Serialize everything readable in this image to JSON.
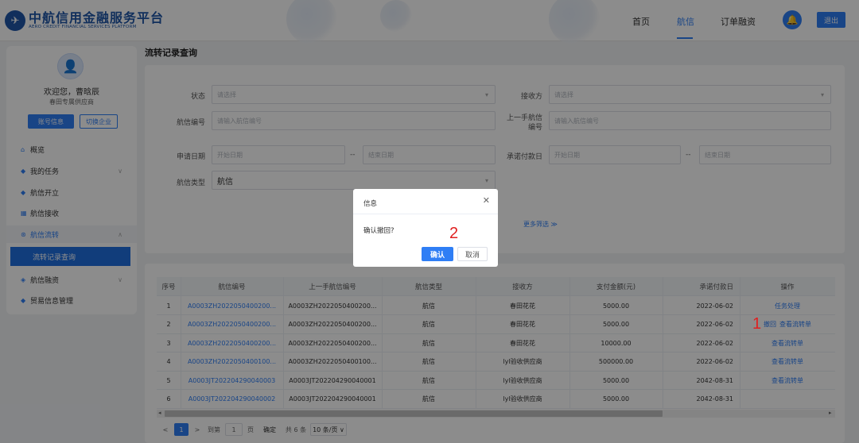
{
  "header": {
    "logo_title": "中航信用金融服务平台",
    "logo_subtitle": "AERO CREDIT FINANCIAL SERVICES PLATFORM",
    "nav": [
      "首页",
      "航信",
      "订单融资"
    ],
    "active_nav": "航信",
    "logout_label": "退出"
  },
  "sidebar": {
    "welcome": "欢迎您，曹晗辰",
    "role": "春田专属供应商",
    "account_button": "账号信息",
    "switch_button": "切换企业",
    "menu": [
      {
        "label": "概览",
        "icon": "home-icon"
      },
      {
        "label": "我的任务",
        "icon": "task-icon",
        "expandable": true
      },
      {
        "label": "航信开立",
        "icon": "open-icon"
      },
      {
        "label": "航信接收",
        "icon": "receive-icon"
      },
      {
        "label": "航信流转",
        "icon": "transfer-icon",
        "expandable": true,
        "expanded": true
      },
      {
        "label": "航信融资",
        "icon": "finance-icon",
        "expandable": true
      },
      {
        "label": "贸易信息管理",
        "icon": "trade-icon"
      }
    ],
    "active_submenu": "流转记录查询"
  },
  "page": {
    "title": "流转记录查询"
  },
  "filters": {
    "status_label": "状态",
    "status_placeholder": "请选择",
    "receiver_label": "接收方",
    "receiver_placeholder": "请选择",
    "code_label": "航信编号",
    "code_placeholder": "请输入航信编号",
    "prev_code_label_line1": "上一手航信",
    "prev_code_label_line2": "编号",
    "prev_code_placeholder": "请输入航信编号",
    "apply_date_label": "申请日期",
    "start_placeholder": "开始日期",
    "end_placeholder": "结束日期",
    "date_separator": "--",
    "pay_date_label": "承诺付款日",
    "pay_start_placeholder": "开始日期",
    "pay_end_placeholder": "结束日期",
    "type_label": "航信类型",
    "type_value": "航信",
    "more_filters": "更多筛选 ≫"
  },
  "table": {
    "columns": [
      "序号",
      "航信编号",
      "上一手航信编号",
      "航信类型",
      "接收方",
      "支付金额(元)",
      "承诺付款日",
      "操作"
    ],
    "rows": [
      {
        "no": "1",
        "code": "A0003ZH2022050400200...",
        "prev": "A0003ZH2022050400200...",
        "type": "航信",
        "receiver": "春田花花",
        "amount": "5000.00",
        "date": "2022-06-02",
        "actions": [
          "任务处理"
        ]
      },
      {
        "no": "2",
        "code": "A0003ZH2022050400200...",
        "prev": "A0003ZH2022050400200...",
        "type": "航信",
        "receiver": "春田花花",
        "amount": "5000.00",
        "date": "2022-06-02",
        "actions": [
          "撤回",
          "查看流转单"
        ]
      },
      {
        "no": "3",
        "code": "A0003ZH2022050400200...",
        "prev": "A0003ZH2022050400200...",
        "type": "航信",
        "receiver": "春田花花",
        "amount": "10000.00",
        "date": "2022-06-02",
        "actions": [
          "查看流转单"
        ]
      },
      {
        "no": "4",
        "code": "A0003ZH2022050400100...",
        "prev": "A0003ZH2022050400100...",
        "type": "航信",
        "receiver": "lyl验收供应商",
        "amount": "500000.00",
        "date": "2022-06-02",
        "actions": [
          "查看流转单"
        ]
      },
      {
        "no": "5",
        "code": "A0003JT202204290040003",
        "prev": "A0003JT202204290040001",
        "type": "航信",
        "receiver": "lyl验收供应商",
        "amount": "5000.00",
        "date": "2042-08-31",
        "actions": [
          "查看流转单"
        ]
      },
      {
        "no": "6",
        "code": "A0003JT202204290040002",
        "prev": "A0003JT202204290040001",
        "type": "航信",
        "receiver": "lyl验收供应商",
        "amount": "5000.00",
        "date": "2042-08-31",
        "actions": []
      }
    ]
  },
  "pagination": {
    "prev": "<",
    "current": "1",
    "next": ">",
    "goto_label": "到第",
    "goto_value": "1",
    "page_unit": "页",
    "confirm": "确定",
    "total": "共 6 条",
    "page_size": "10 条/页 ∨"
  },
  "dialog": {
    "title": "信息",
    "message": "确认撤回?",
    "confirm": "确认",
    "cancel": "取消"
  },
  "annotations": [
    "1",
    "2"
  ]
}
